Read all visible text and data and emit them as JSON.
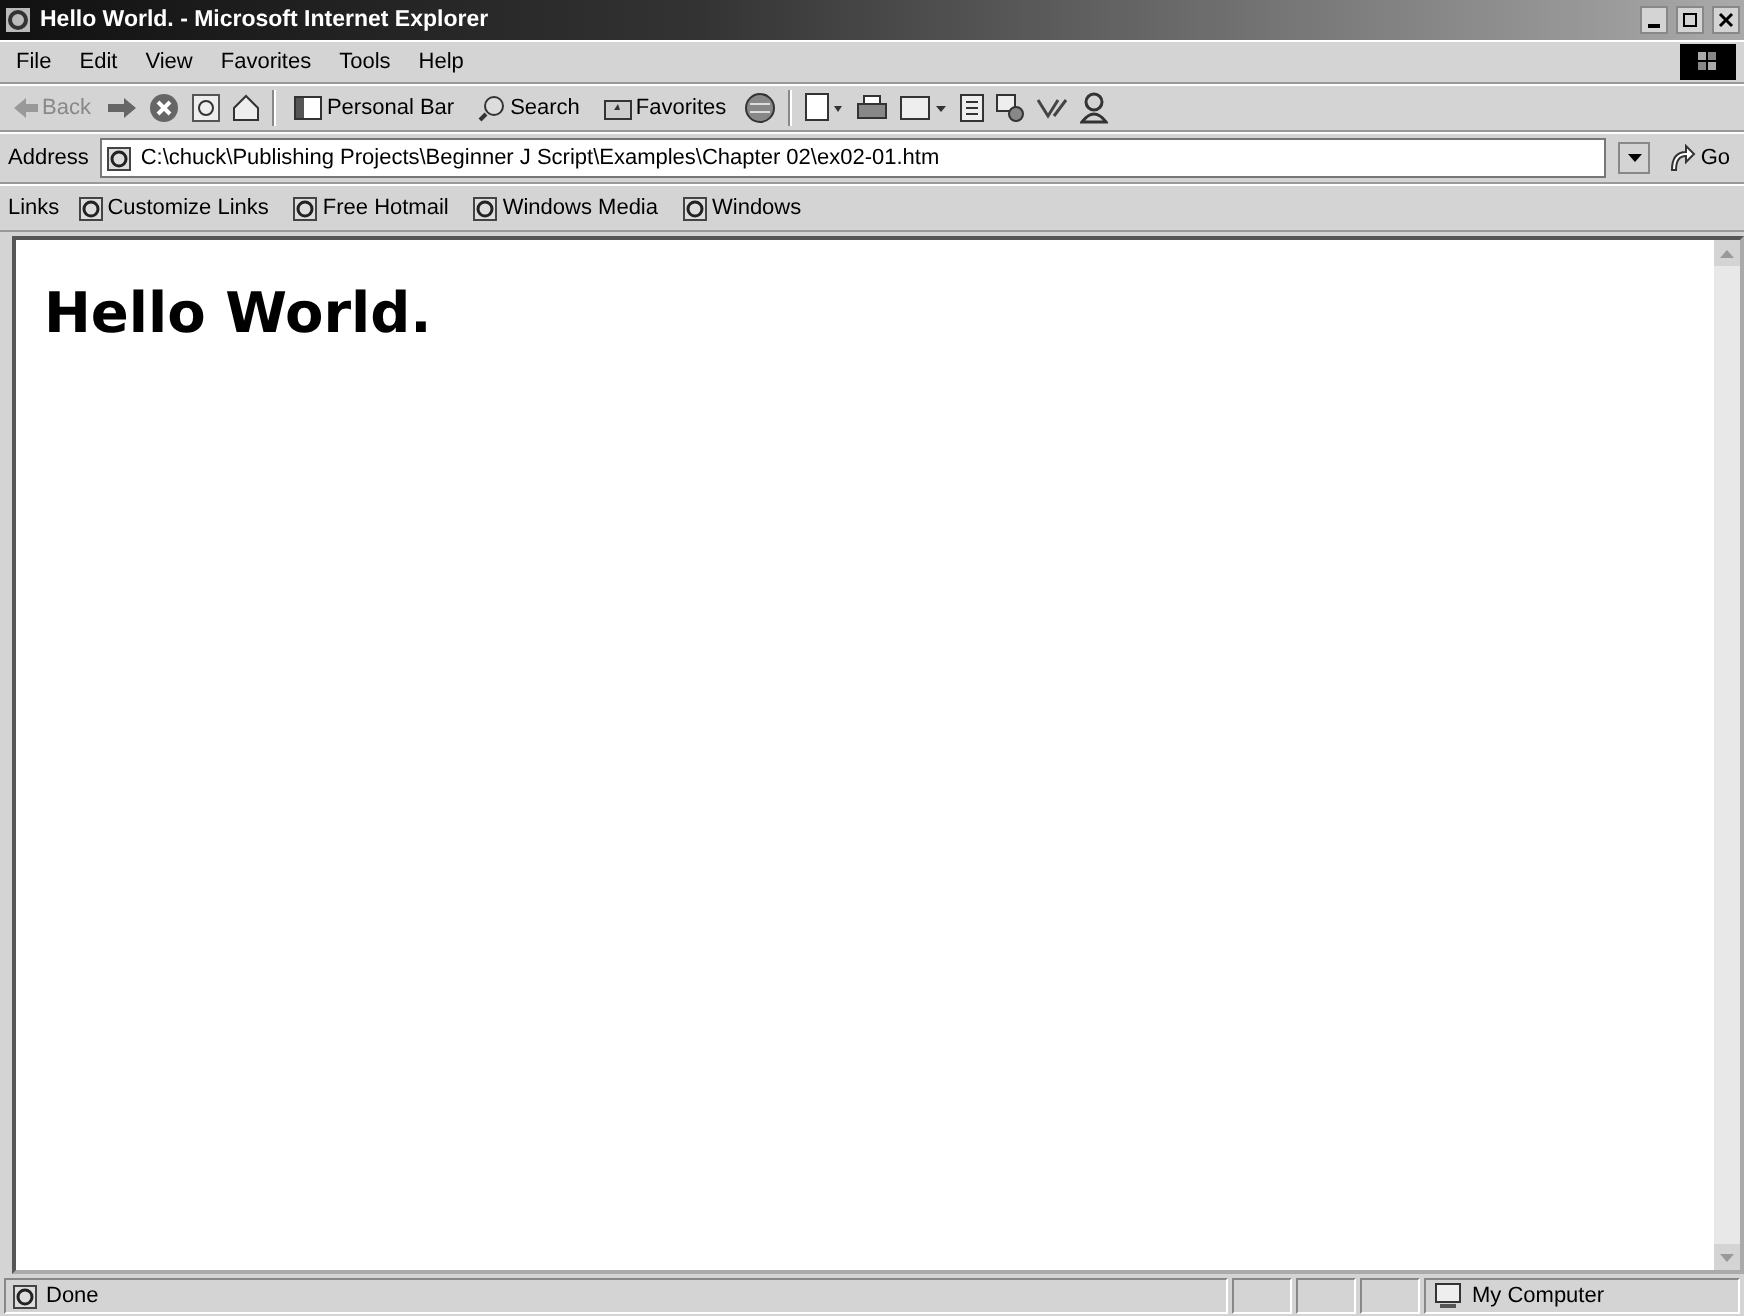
{
  "window": {
    "title": "Hello World. - Microsoft Internet Explorer"
  },
  "menu": [
    "File",
    "Edit",
    "View",
    "Favorites",
    "Tools",
    "Help"
  ],
  "toolbar": {
    "back": "Back",
    "personal_bar": "Personal Bar",
    "search": "Search",
    "favorites": "Favorites"
  },
  "address_bar": {
    "label": "Address",
    "value": "C:\\chuck\\Publishing Projects\\Beginner J Script\\Examples\\Chapter 02\\ex02-01.htm",
    "go": "Go"
  },
  "links_bar": {
    "label": "Links",
    "items": [
      "Customize Links",
      "Free Hotmail",
      "Windows Media",
      "Windows"
    ]
  },
  "page": {
    "heading": "Hello World."
  },
  "status_bar": {
    "text": "Done",
    "zone": "My Computer"
  }
}
